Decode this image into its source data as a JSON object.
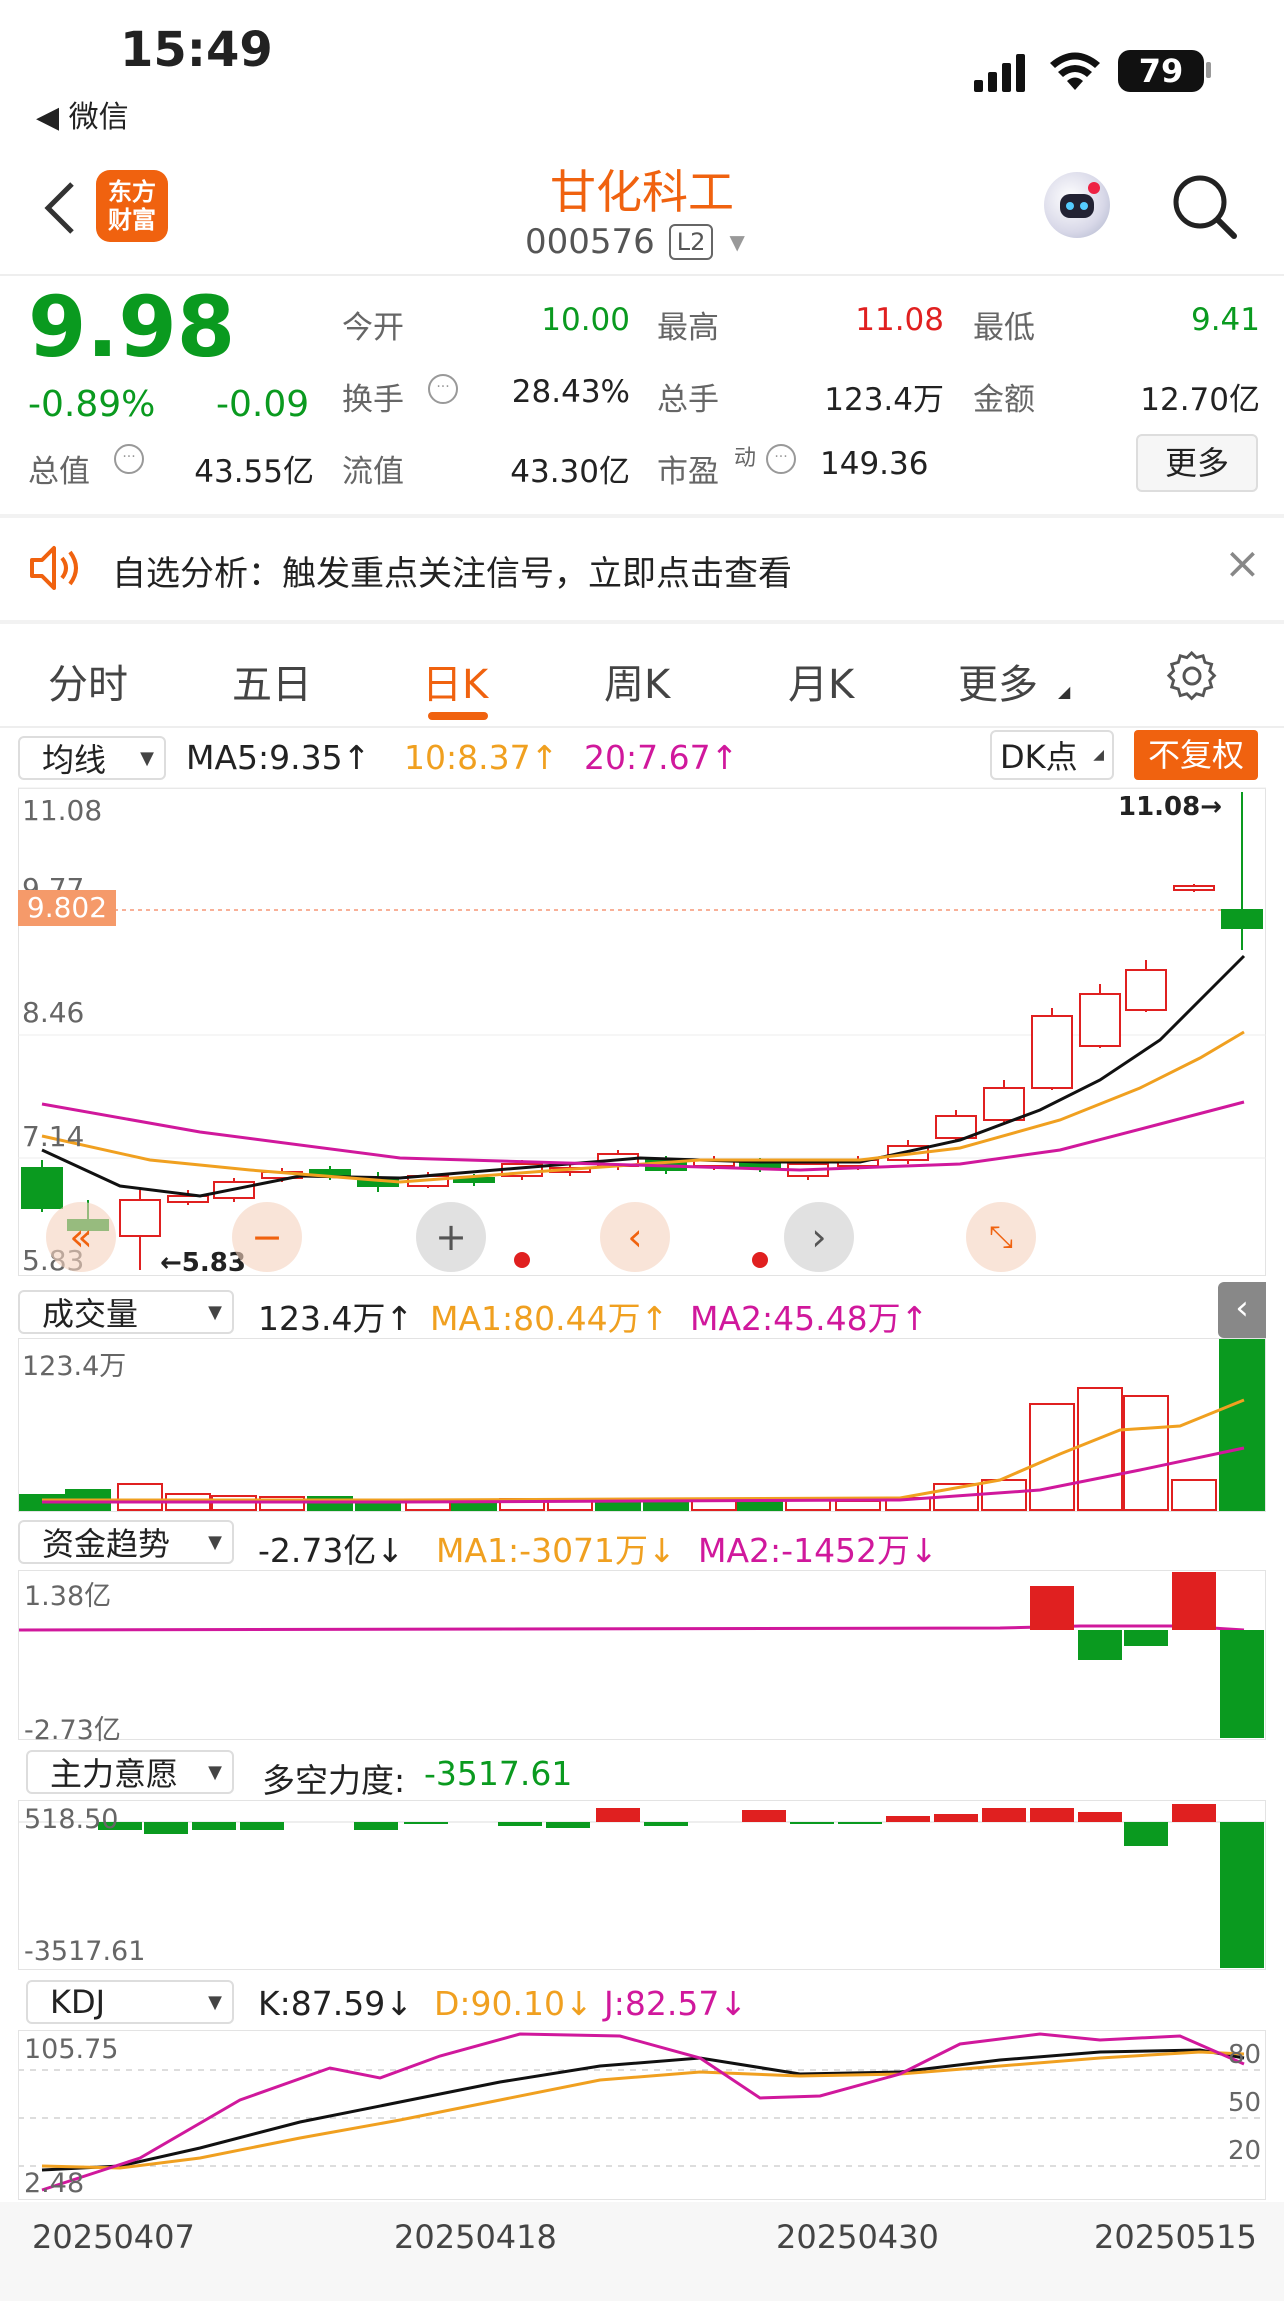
{
  "status_bar": {
    "time": "15:49",
    "back_app": "◀ 微信",
    "battery": "79"
  },
  "header": {
    "title": "甘化科工",
    "code": "000576",
    "badge": "L2",
    "logo_line1": "东方",
    "logo_line2": "财富"
  },
  "quote": {
    "price": "9.98",
    "change_pct": "-0.89%",
    "change": "-0.09",
    "open_label": "今开",
    "open": "10.00",
    "high_label": "最高",
    "high": "11.08",
    "low_label": "最低",
    "low": "9.41",
    "turnover_label": "换手",
    "turnover": "28.43%",
    "volume_label": "总手",
    "volume": "123.4万",
    "amount_label": "金额",
    "amount": "12.70亿",
    "mktcap_label": "总值",
    "mktcap": "43.55亿",
    "float_label": "流值",
    "float": "43.30亿",
    "pe_label": "市盈",
    "pe_sup": "动",
    "pe": "149.36",
    "more": "更多"
  },
  "banner": {
    "text": "自选分析：触发重点关注信号，立即点击查看",
    "close": "×"
  },
  "tabs": [
    {
      "label": "分时"
    },
    {
      "label": "五日"
    },
    {
      "label": "日K"
    },
    {
      "label": "周K"
    },
    {
      "label": "月K"
    },
    {
      "label": "更多"
    }
  ],
  "kline": {
    "selector": "均线",
    "ma5": "MA5:9.35↑",
    "ma10": "10:8.37↑",
    "ma20": "20:7.67↑",
    "dk": "DK点",
    "fq": "不复权",
    "y_top": "11.08",
    "y_977": "9.77",
    "y_cur": "9.802",
    "y_mid": "8.46",
    "y_low": "7.14",
    "y_bot": "5.83",
    "max_note": "11.08→",
    "min_note": "←5.83"
  },
  "volume": {
    "selector": "成交量",
    "val": "123.4万↑",
    "ma1": "MA1:80.44万↑",
    "ma2": "MA2:45.48万↑",
    "top": "123.4万"
  },
  "fund": {
    "selector": "资金趋势",
    "val": "-2.73亿↓",
    "ma1": "MA1:-3071万↓",
    "ma2": "MA2:-1452万↓",
    "top": "1.38亿",
    "bot": "-2.73亿"
  },
  "main_force": {
    "selector": "主力意愿",
    "label": "多空力度:",
    "val": "-3517.61",
    "top": "518.50",
    "bot": "-3517.61"
  },
  "kdj": {
    "selector": "KDJ",
    "k": "K:87.59↓",
    "d": "D:90.10↓",
    "j": "J:82.57↓",
    "top": "105.75",
    "bot": "2.48",
    "l80": "80",
    "l50": "50",
    "l20": "20"
  },
  "dates": [
    "20250407",
    "20250418",
    "20250430",
    "20250515"
  ],
  "colors": {
    "brand": "#f0620f",
    "up": "#e02020",
    "down": "#0a9a1f",
    "ma10": "#f0a020",
    "ma20": "#d0189c"
  }
}
